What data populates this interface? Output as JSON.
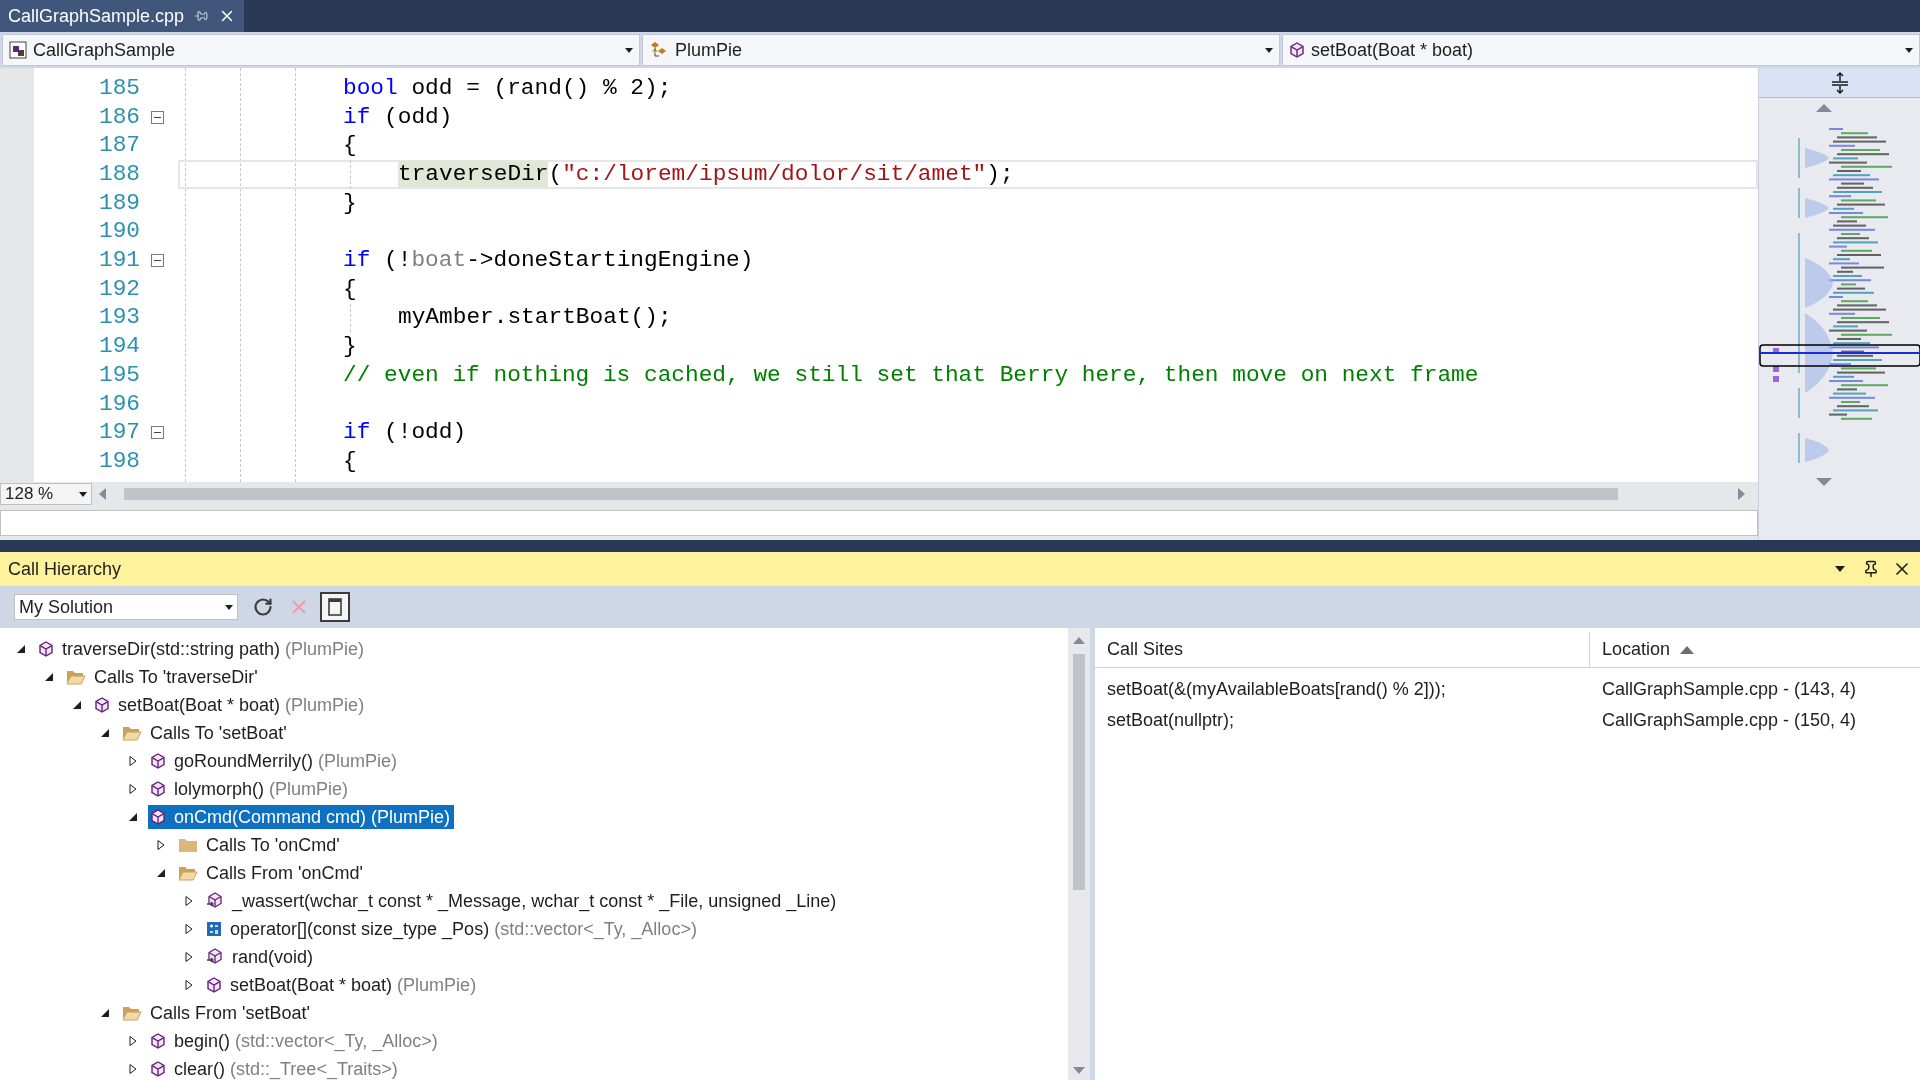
{
  "tab": {
    "title": "CallGraphSample.cpp"
  },
  "nav": [
    {
      "kind": "project",
      "text": "CallGraphSample"
    },
    {
      "kind": "class",
      "text": "PlumPie"
    },
    {
      "kind": "method",
      "text": "setBoat(Boat * boat)"
    }
  ],
  "code": {
    "lines": [
      {
        "number": "185",
        "fold": false,
        "current": false,
        "indented": false,
        "tokens": [
          {
            "kind": "keyword",
            "text": "bool"
          },
          {
            "kind": "plain",
            "text": " odd = (rand() % 2);"
          }
        ]
      },
      {
        "number": "186",
        "fold": true,
        "current": false,
        "indented": false,
        "tokens": [
          {
            "kind": "keyword",
            "text": "if"
          },
          {
            "kind": "plain",
            "text": " (odd)"
          }
        ]
      },
      {
        "number": "187",
        "fold": false,
        "current": false,
        "indented": false,
        "tokens": [
          {
            "kind": "plain",
            "text": "{"
          }
        ]
      },
      {
        "number": "188",
        "fold": false,
        "current": true,
        "indented": true,
        "tokens": [
          {
            "kind": "reference",
            "text": "traverseDir"
          },
          {
            "kind": "plain",
            "text": "("
          },
          {
            "kind": "string",
            "text": "\"c:/lorem/ipsum/dolor/sit/amet\""
          },
          {
            "kind": "plain",
            "text": ");"
          }
        ]
      },
      {
        "number": "189",
        "fold": false,
        "current": false,
        "indented": false,
        "tokens": [
          {
            "kind": "plain",
            "text": "}"
          }
        ]
      },
      {
        "number": "190",
        "fold": false,
        "current": false,
        "indented": false
      },
      {
        "number": "191",
        "fold": true,
        "current": false,
        "indented": false,
        "tokens": [
          {
            "kind": "keyword",
            "text": "if"
          },
          {
            "kind": "plain",
            "text": " (!"
          },
          {
            "kind": "parameter",
            "text": "boat"
          },
          {
            "kind": "plain",
            "text": "->doneStartingEngine)"
          }
        ]
      },
      {
        "number": "192",
        "fold": false,
        "current": false,
        "indented": false,
        "tokens": [
          {
            "kind": "plain",
            "text": "{"
          }
        ]
      },
      {
        "number": "193",
        "fold": false,
        "current": false,
        "indented": true,
        "tokens": [
          {
            "kind": "plain",
            "text": "myAmber.startBoat();"
          }
        ]
      },
      {
        "number": "194",
        "fold": false,
        "current": false,
        "indented": false,
        "tokens": [
          {
            "kind": "plain",
            "text": "}"
          }
        ]
      },
      {
        "number": "195",
        "fold": false,
        "current": false,
        "indented": false,
        "tokens": [
          {
            "kind": "comment",
            "text": "// even if nothing is cached, we still set that Berry here, then move on next frame"
          }
        ]
      },
      {
        "number": "196",
        "fold": false,
        "current": false,
        "indented": false
      },
      {
        "number": "197",
        "fold": true,
        "current": false,
        "indented": false,
        "tokens": [
          {
            "kind": "keyword",
            "text": "if"
          },
          {
            "kind": "plain",
            "text": " (!odd)"
          }
        ]
      },
      {
        "number": "198",
        "fold": false,
        "current": false,
        "indented": false,
        "tokens": [
          {
            "kind": "plain",
            "text": "{"
          }
        ]
      }
    ],
    "zoom": "128 %"
  },
  "call_hierarchy": {
    "title": "Call Hierarchy",
    "scope": "My Solution",
    "toolbar": [
      {
        "kind": "refresh",
        "disabled": false,
        "pressed": false
      },
      {
        "kind": "cancel",
        "disabled": true,
        "pressed": false
      },
      {
        "kind": "layout",
        "disabled": false,
        "pressed": true
      }
    ],
    "tree": [
      {
        "kind": "method",
        "name": "traverseDir(std::string path)",
        "owner": "(PlumPie)",
        "expanded": true,
        "selected": false,
        "children": [
          {
            "kind": "folder",
            "name": "Calls To 'traverseDir'",
            "expanded": true,
            "selected": false,
            "children": [
              {
                "kind": "method",
                "name": "setBoat(Boat * boat)",
                "owner": "(PlumPie)",
                "expanded": true,
                "selected": false,
                "children": [
                  {
                    "kind": "folder",
                    "name": "Calls To 'setBoat'",
                    "expanded": true,
                    "selected": false,
                    "children": [
                      {
                        "kind": "method",
                        "name": "goRoundMerrily()",
                        "owner": "(PlumPie)",
                        "expanded": false,
                        "selected": false
                      },
                      {
                        "kind": "method",
                        "name": "lolymorph()",
                        "owner": "(PlumPie)",
                        "expanded": false,
                        "selected": false
                      },
                      {
                        "kind": "method",
                        "name": "onCmd(Command cmd)",
                        "owner": "(PlumPie)",
                        "expanded": true,
                        "selected": true,
                        "children": [
                          {
                            "kind": "folder",
                            "name": "Calls To 'onCmd'",
                            "expanded": false,
                            "selected": false
                          },
                          {
                            "kind": "folder",
                            "name": "Calls From 'onCmd'",
                            "expanded": true,
                            "selected": false,
                            "children": [
                              {
                                "kind": "external",
                                "name": "_wassert(wchar_t const * _Message, wchar_t const * _File, unsigned _Line)",
                                "expanded": false,
                                "selected": false
                              },
                              {
                                "kind": "operator",
                                "name": "operator[](const size_type _Pos)",
                                "owner": "(std::vector<_Ty, _Alloc>)",
                                "expanded": false,
                                "selected": false
                              },
                              {
                                "kind": "external",
                                "name": "rand(void)",
                                "expanded": false,
                                "selected": false
                              },
                              {
                                "kind": "method",
                                "name": "setBoat(Boat * boat)",
                                "owner": "(PlumPie)",
                                "expanded": false,
                                "selected": false
                              }
                            ]
                          }
                        ]
                      }
                    ]
                  },
                  {
                    "kind": "folder",
                    "name": "Calls From 'setBoat'",
                    "expanded": true,
                    "selected": false,
                    "children": [
                      {
                        "kind": "method",
                        "name": "begin()",
                        "owner": "(std::vector<_Ty, _Alloc>)",
                        "expanded": false,
                        "selected": false
                      },
                      {
                        "kind": "method",
                        "name": "clear()",
                        "owner": "(std::_Tree<_Traits>)",
                        "expanded": false,
                        "selected": false
                      }
                    ]
                  }
                ]
              }
            ]
          }
        ]
      }
    ]
  },
  "call_sites": {
    "columns": [
      {
        "label": "Call Sites",
        "sorted": false
      },
      {
        "label": "Location",
        "sorted": true
      }
    ],
    "rows": [
      {
        "call_site": "setBoat(&(myAvailableBoats[rand() % 2]));",
        "location": "CallGraphSample.cpp - (143, 4)"
      },
      {
        "call_site": "setBoat(nullptr);",
        "location": "CallGraphSample.cpp - (150, 4)"
      }
    ]
  }
}
